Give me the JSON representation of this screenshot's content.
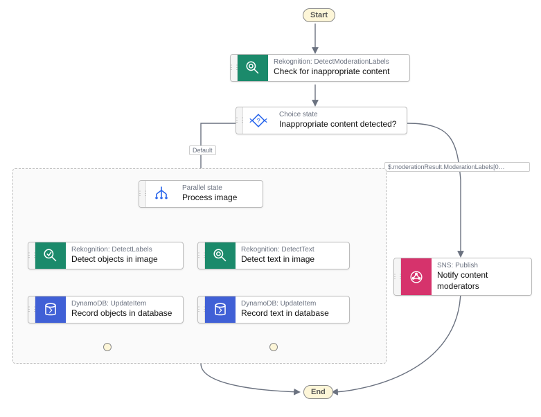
{
  "start": {
    "label": "Start"
  },
  "end": {
    "label": "End"
  },
  "nodes": {
    "check": {
      "service": "Rekognition: DetectModerationLabels",
      "action": "Check for inappropriate content"
    },
    "choice": {
      "service": "Choice state",
      "action": "Inappropriate content detected?"
    },
    "parallel": {
      "service": "Parallel state",
      "action": "Process image"
    },
    "detectObjects": {
      "service": "Rekognition: DetectLabels",
      "action": "Detect objects in image"
    },
    "detectText": {
      "service": "Rekognition: DetectText",
      "action": "Detect text in image"
    },
    "recordObjects": {
      "service": "DynamoDB: UpdateItem",
      "action": "Record objects in database"
    },
    "recordText": {
      "service": "DynamoDB: UpdateItem",
      "action": "Record text in database"
    },
    "notify": {
      "service": "SNS: Publish",
      "action": "Notify content moderators"
    }
  },
  "edgeLabels": {
    "default": "Default",
    "condition": "$.moderationResult.ModerationLabels[0…"
  }
}
